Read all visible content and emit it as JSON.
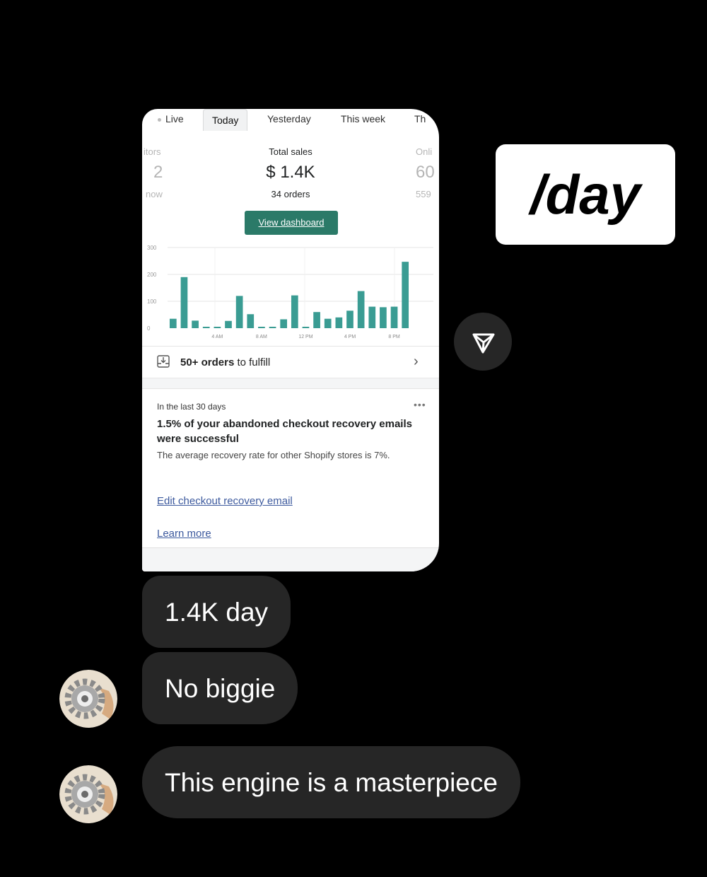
{
  "card": {
    "tabs": [
      "Live",
      "Today",
      "Yesterday",
      "This week",
      "Th"
    ],
    "active_tab": "Today",
    "left_metric": {
      "label": "itors",
      "value": "2",
      "sub": "now"
    },
    "total_sales": {
      "label": "Total sales",
      "value": "$ 1.4K",
      "sub": "34 orders"
    },
    "right_metric": {
      "label": "Onli",
      "value": "60",
      "sub": "559"
    },
    "view_dashboard": "View dashboard",
    "fulfill": {
      "count": "50+ orders",
      "suffix": " to fulfill"
    },
    "recovery": {
      "period": "In the last 30 days",
      "headline": "1.5% of your abandoned checkout recovery emails were successful",
      "description": "The average recovery rate for other Shopify stores is 7%.",
      "edit_link": "Edit checkout recovery email",
      "learn_more": "Learn more"
    },
    "more_icon": "more-horizontal-icon"
  },
  "chart_data": {
    "type": "bar",
    "categories": [
      "12 AM",
      "1 AM",
      "2 AM",
      "3 AM",
      "4 AM",
      "5 AM",
      "6 AM",
      "7 AM",
      "8 AM",
      "9 AM",
      "10 AM",
      "11 AM",
      "12 PM",
      "1 PM",
      "2 PM",
      "3 PM",
      "4 PM",
      "5 PM",
      "6 PM",
      "7 PM",
      "8 PM",
      "9 PM"
    ],
    "values": [
      35,
      190,
      28,
      3,
      3,
      27,
      120,
      52,
      3,
      3,
      33,
      122,
      3,
      60,
      35,
      40,
      65,
      138,
      80,
      78,
      80,
      247
    ],
    "xticks": [
      "4 AM",
      "8 AM",
      "12 PM",
      "4 PM",
      "8 PM"
    ],
    "yticks": [
      0,
      100,
      200,
      300
    ],
    "ylim": [
      0,
      300
    ],
    "bar_color": "#3a9c93",
    "grid": true
  },
  "sticker": {
    "text": "/day"
  },
  "share_icon": "send-icon",
  "messages": [
    {
      "text": "1.4K day",
      "avatar": false
    },
    {
      "text": "No biggie",
      "avatar": true
    },
    {
      "text": "This engine is a masterpiece",
      "avatar": true
    }
  ],
  "avatar_icon": "gear-icon"
}
